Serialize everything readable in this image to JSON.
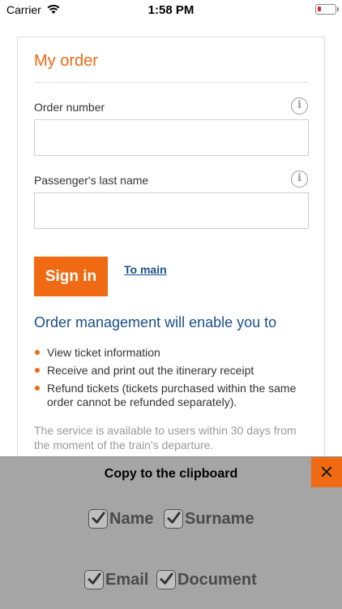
{
  "status_bar": {
    "carrier": "Carrier",
    "time": "1:58 PM"
  },
  "order_form": {
    "title": "My order",
    "order_number_label": "Order number",
    "order_number_value": "",
    "last_name_label": "Passenger's last name",
    "last_name_value": "",
    "sign_in_label": "Sign in",
    "to_main_label": "To main"
  },
  "info_section": {
    "heading": "Order management will enable you to",
    "features": [
      "View ticket information",
      "Receive and print out the itinerary receipt",
      "Refund tickets (tickets purchased within the same order cannot be refunded separately)."
    ],
    "note": "The service is available to users within 30 days from the moment of the train's departure."
  },
  "clipboard_panel": {
    "title": "Copy to the clipboard",
    "close_glyph": "✕",
    "options": [
      {
        "label": "Name",
        "checked": true
      },
      {
        "label": "Surname",
        "checked": true
      },
      {
        "label": "Email",
        "checked": true
      },
      {
        "label": "Document",
        "checked": true
      }
    ]
  },
  "colors": {
    "accent": "#ef6a12",
    "link": "#1a4f8b",
    "overlay": "#a5a5a5",
    "battery_low": "#e0262b"
  }
}
